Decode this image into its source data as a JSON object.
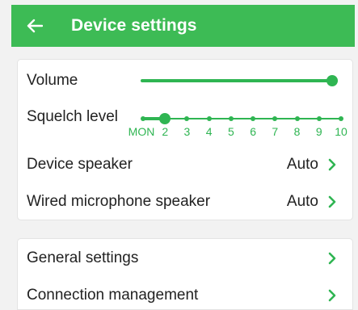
{
  "header": {
    "title": "Device settings",
    "back_icon": "arrow-left-icon",
    "background": "#3dbb55"
  },
  "audio": {
    "volume": {
      "label": "Volume",
      "level": 0.97
    },
    "squelch": {
      "label": "Squelch level",
      "ticks": [
        "MON",
        "2",
        "3",
        "4",
        "5",
        "6",
        "7",
        "8",
        "9",
        "10"
      ],
      "selected": "2"
    },
    "device_speaker": {
      "label": "Device speaker",
      "value": "Auto"
    },
    "wired_mic": {
      "label": "Wired microphone speaker",
      "value": "Auto"
    }
  },
  "menu": {
    "general": {
      "label": "General settings"
    },
    "connection": {
      "label": "Connection management"
    }
  },
  "accent_color": "#2fb552",
  "chevron_icon": "chevron-right-icon"
}
